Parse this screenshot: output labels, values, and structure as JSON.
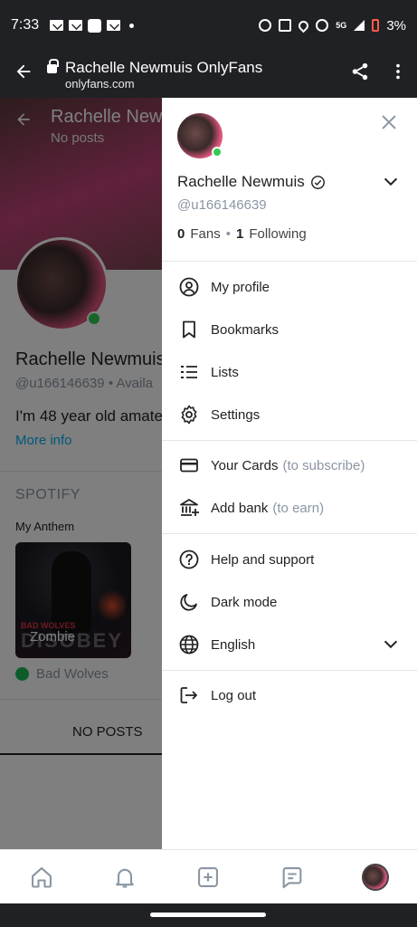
{
  "status_bar": {
    "time": "7:33",
    "network": "5G",
    "battery": "3%"
  },
  "browser": {
    "title": "Rachelle Newmuis OnlyFans",
    "url": "onlyfans.com"
  },
  "profile_page": {
    "header_name": "Rachelle Newmuis",
    "header_sub": "No posts",
    "name": "Rachelle Newmuis",
    "handle": "@u166146639",
    "availability": "Availa",
    "bio": "I'm 48 year old amate",
    "more_info": "More info",
    "spotify_heading": "SPOTIFY",
    "anthem_label": "My Anthem",
    "album_band": "BAD WOLVES",
    "album_title": "DISOBEY",
    "song": "Zombie",
    "artist": "Bad Wolves",
    "tab_label": "NO POSTS"
  },
  "drawer": {
    "display_name": "Rachelle Newmuis",
    "username": "@u166146639",
    "fans_count": "0",
    "fans_label": "Fans",
    "following_count": "1",
    "following_label": "Following",
    "menu": {
      "my_profile": "My profile",
      "bookmarks": "Bookmarks",
      "lists": "Lists",
      "settings": "Settings",
      "your_cards": "Your Cards",
      "your_cards_hint": "(to subscribe)",
      "add_bank": "Add bank",
      "add_bank_hint": "(to earn)",
      "help": "Help and support",
      "dark_mode": "Dark mode",
      "language": "English",
      "log_out": "Log out"
    }
  },
  "colors": {
    "accent": "#00aff0",
    "online": "#2ecc52",
    "muted": "#8a96a3"
  }
}
